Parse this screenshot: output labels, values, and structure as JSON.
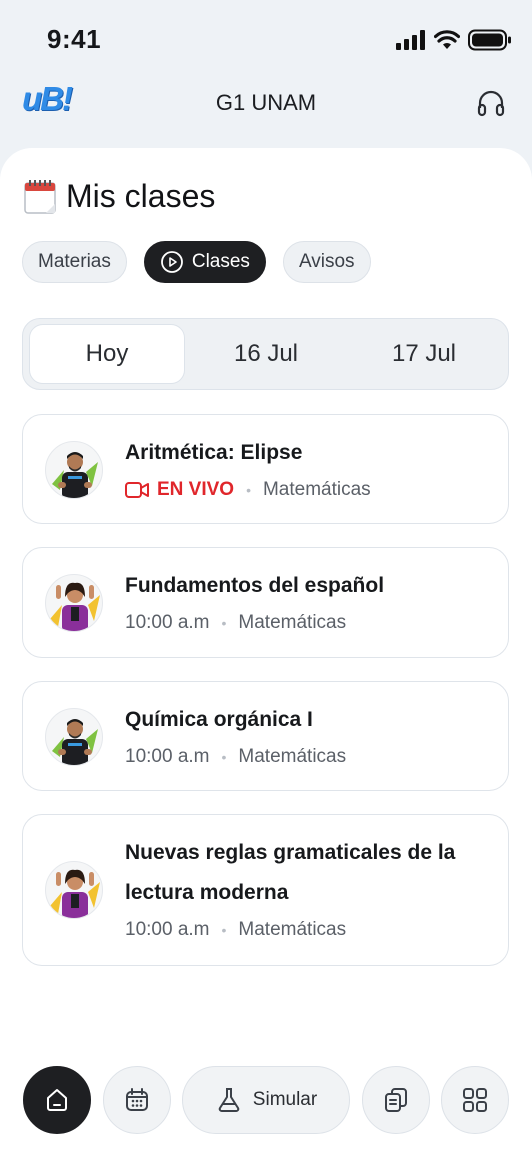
{
  "status_bar": {
    "time": "9:41"
  },
  "header": {
    "logo_text": "uB!",
    "title": "G1 UNAM"
  },
  "page": {
    "title": "Mis clases"
  },
  "chips": [
    {
      "label": "Materias",
      "active": false
    },
    {
      "label": "Clases",
      "active": true
    },
    {
      "label": "Avisos",
      "active": false
    }
  ],
  "date_tabs": [
    {
      "label": "Hoy",
      "selected": true
    },
    {
      "label": "16 Jul",
      "selected": false
    },
    {
      "label": "17 Jul",
      "selected": false
    }
  ],
  "classes": [
    {
      "title": "Aritmética: Elipse",
      "status": "EN VIVO",
      "subject": "Matemáticas",
      "teacher": "male"
    },
    {
      "title": "Fundamentos del español",
      "time": "10:00 a.m",
      "subject": "Matemáticas",
      "teacher": "female"
    },
    {
      "title": "Química orgánica I",
      "time": "10:00 a.m",
      "subject": "Matemáticas",
      "teacher": "male"
    },
    {
      "title": "Nuevas reglas gramaticales de la lectura moderna",
      "time": "10:00 a.m",
      "subject": "Matemáticas",
      "teacher": "female"
    }
  ],
  "bottom_nav": {
    "simular_label": "Simular"
  },
  "colors": {
    "accent_dark": "#1e1f22",
    "live_red": "#e0262b",
    "logo_blue": "#2f8be6"
  },
  "icons": [
    "signal-icon",
    "wifi-icon",
    "battery-icon",
    "headphones-icon",
    "calendar-icon",
    "play-circle-icon",
    "video-camera-icon",
    "home-icon",
    "flask-icon",
    "cards-icon",
    "grid-icon"
  ]
}
